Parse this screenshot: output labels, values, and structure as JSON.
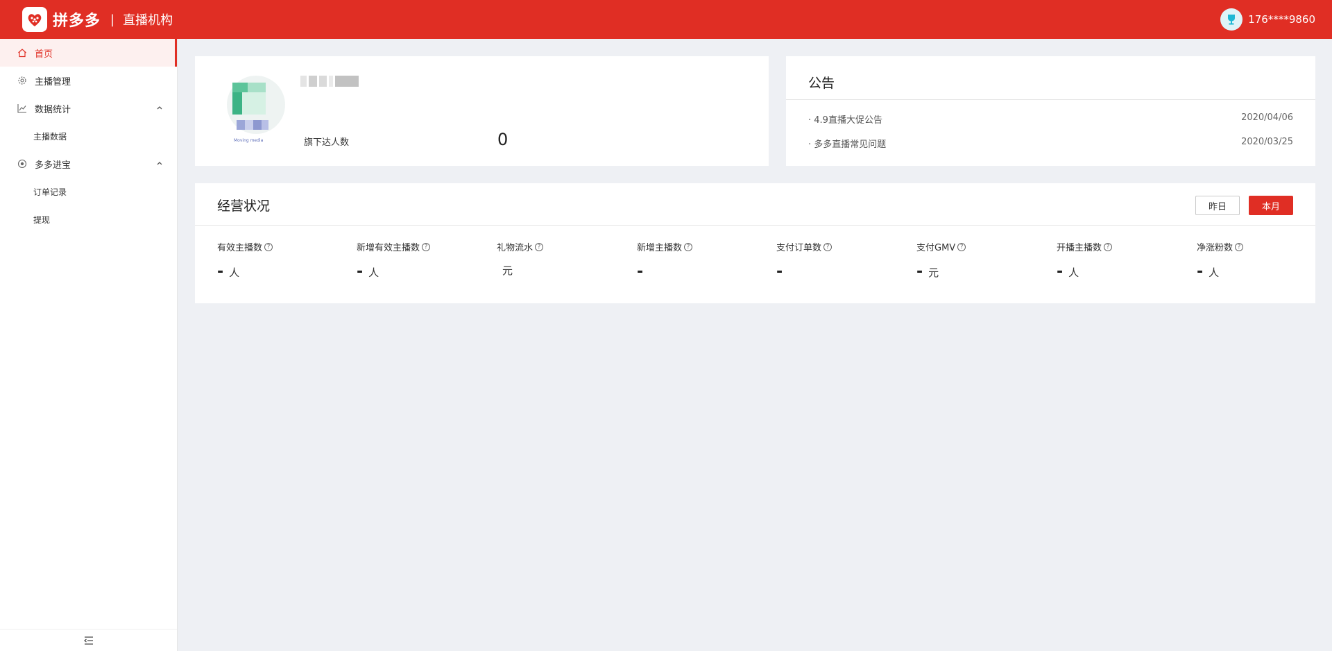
{
  "header": {
    "brand": "拼多多",
    "separator": "|",
    "subtitle": "直播机构",
    "user": "176****9860"
  },
  "sidebar": {
    "items": [
      {
        "label": "首页",
        "icon": "home-icon"
      },
      {
        "label": "主播管理",
        "icon": "gear-icon"
      },
      {
        "label": "数据统计",
        "icon": "chart-line-icon"
      },
      {
        "label": "主播数据"
      },
      {
        "label": "多多进宝",
        "icon": "target-icon"
      },
      {
        "label": "订单记录"
      },
      {
        "label": "提现"
      }
    ]
  },
  "profile": {
    "avatar_caption": "Moving media",
    "subordinate_label": "旗下达人数",
    "subordinate_value": "0"
  },
  "notice": {
    "title": "公告",
    "items": [
      {
        "text": "· 4.9直播大促公告",
        "date": "2020/04/06"
      },
      {
        "text": "· 多多直播常见问题",
        "date": "2020/03/25"
      }
    ]
  },
  "business": {
    "title": "经营状况",
    "buttons": {
      "yesterday": "昨日",
      "month": "本月"
    },
    "metrics": [
      {
        "label": "有效主播数",
        "value": "-",
        "unit": "人"
      },
      {
        "label": "新增有效主播数",
        "value": "-",
        "unit": "人"
      },
      {
        "label": "礼物流水",
        "value": "",
        "unit": "元"
      },
      {
        "label": "新增主播数",
        "value": "-",
        "unit": ""
      },
      {
        "label": "支付订单数",
        "value": "-",
        "unit": ""
      },
      {
        "label": "支付GMV",
        "value": "-",
        "unit": "元"
      },
      {
        "label": "开播主播数",
        "value": "-",
        "unit": "人"
      },
      {
        "label": "净涨粉数",
        "value": "-",
        "unit": "人"
      }
    ],
    "help_glyph": "?"
  },
  "colors": {
    "brand_red": "#e02e24",
    "page_bg": "#eef0f4"
  }
}
